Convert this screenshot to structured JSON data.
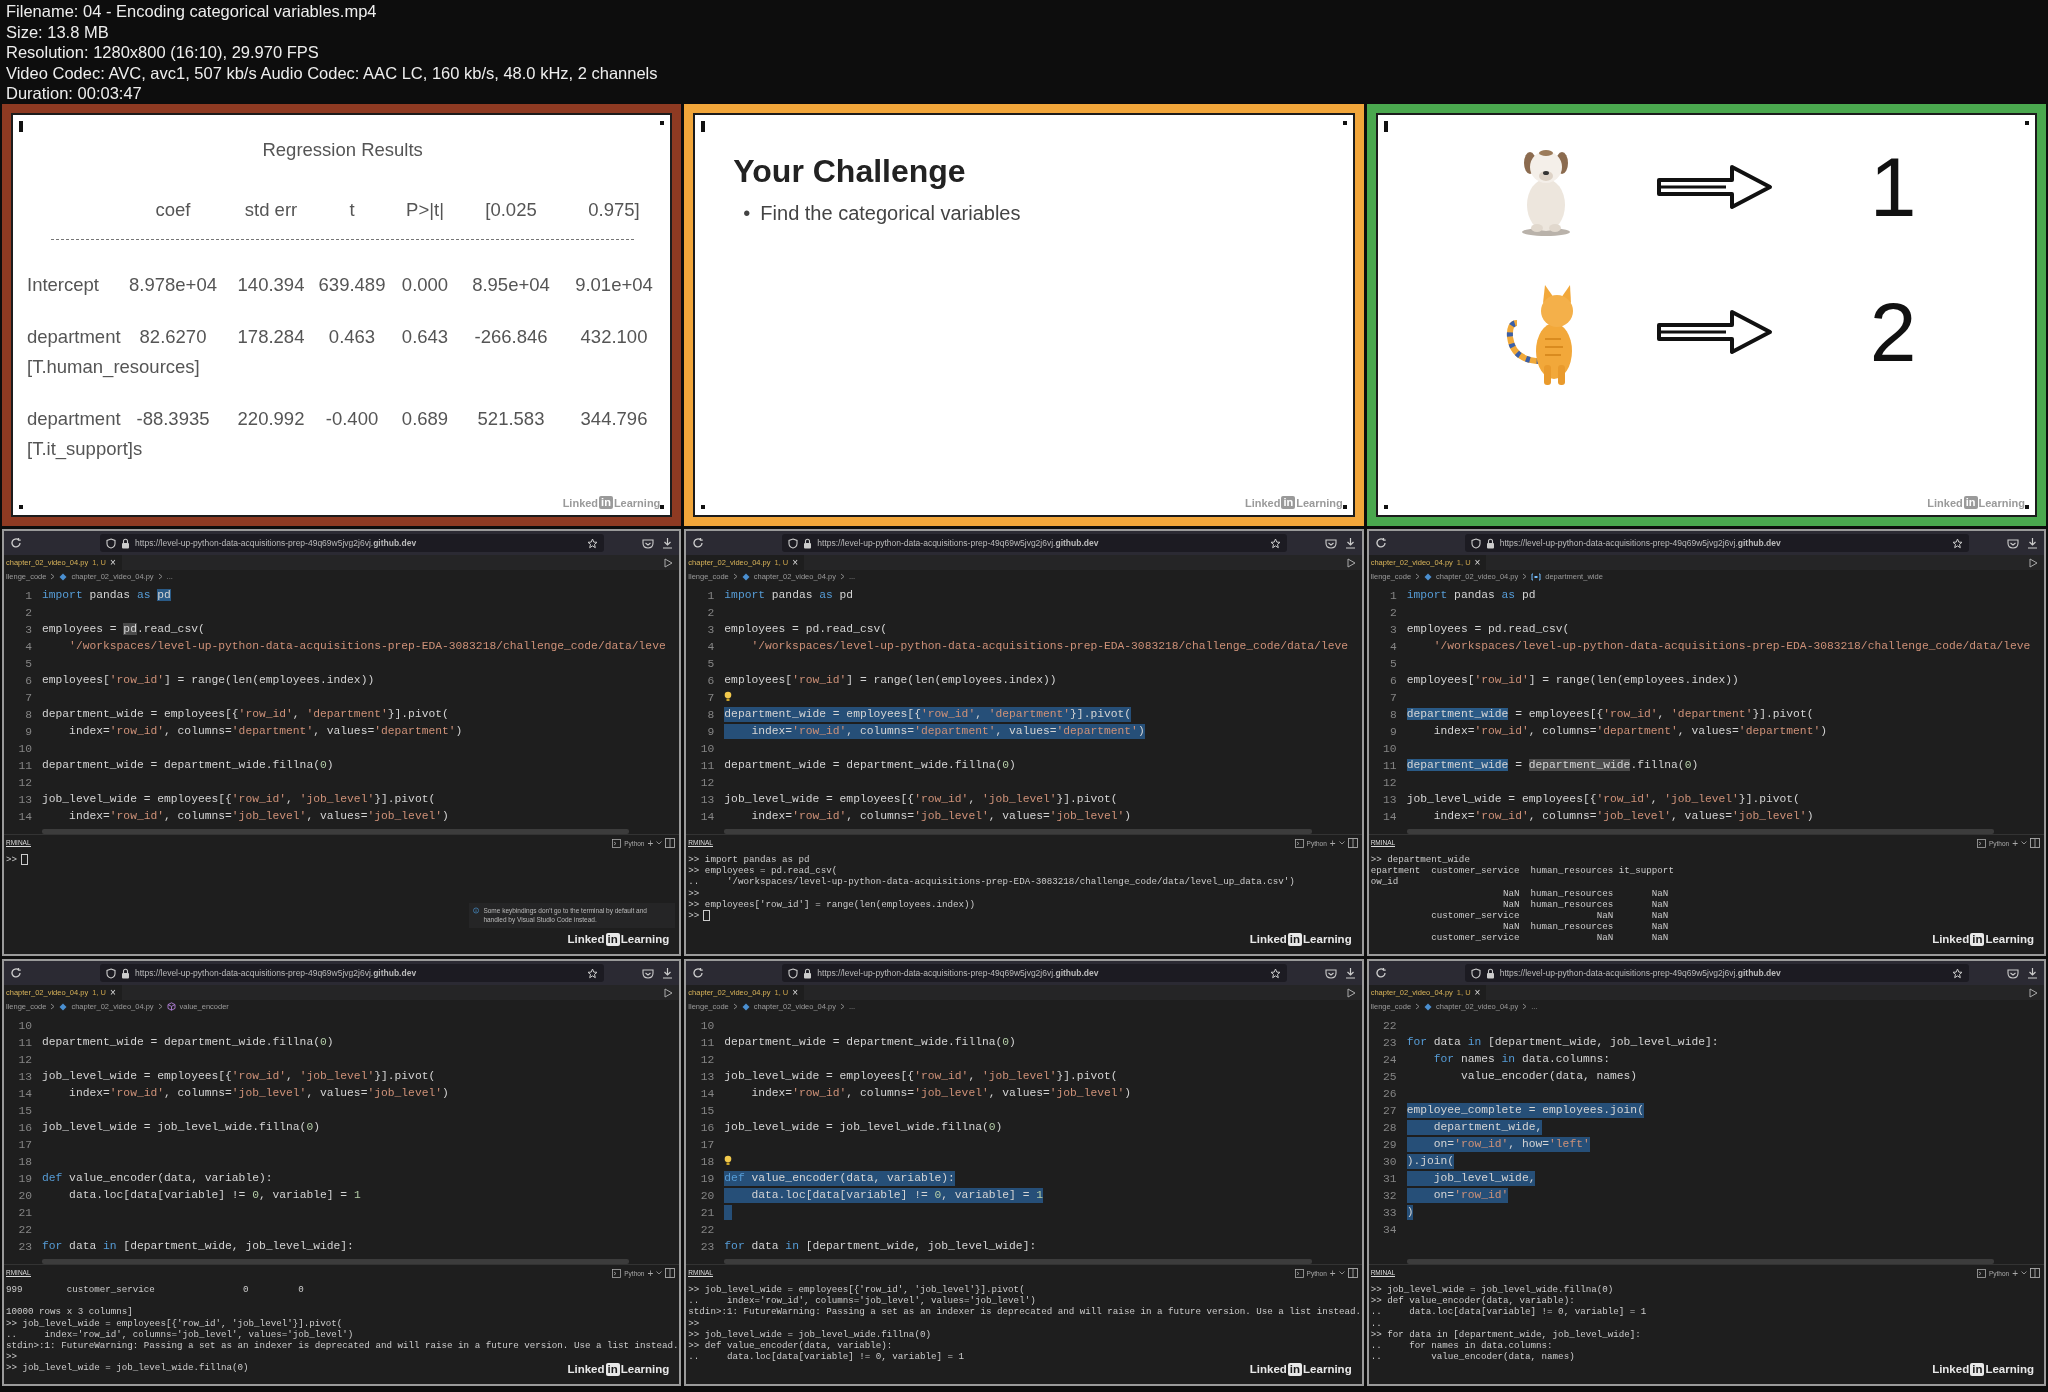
{
  "header": [
    "Filename: 04 - Encoding categorical variables.mp4",
    "Size: 13.8 MB",
    "Resolution: 1280x800 (16:10), 29.970 FPS",
    "Video Codec: AVC, avc1, 507 kb/s Audio Codec: AAC LC, 160 kb/s, 48.0 kHz, 2 channels",
    "Duration: 00:03:47"
  ],
  "frames": [
    {
      "kind": "regression",
      "color": "#8e3a22",
      "title": "Regression Results",
      "columns": [
        "coef",
        "std err",
        "t",
        "P>|t|",
        "[0.025",
        "0.975]"
      ],
      "rows": [
        {
          "label": "Intercept",
          "values": [
            "8.978e+04",
            "140.394",
            "639.489",
            "0.000",
            "8.95e+04",
            "9.01e+04"
          ]
        },
        {
          "label": "department",
          "sublabel": "[T.human_resources]",
          "values": [
            "82.6270",
            "178.284",
            "0.463",
            "0.643",
            "-266.846",
            "432.100"
          ]
        },
        {
          "label": "department",
          "sublabel": "[T.it_support]s",
          "values": [
            "-88.3935",
            "220.992",
            "-0.400",
            "0.689",
            "521.583",
            "344.796"
          ]
        }
      ],
      "logo": {
        "word1": "Linked",
        "badge": "in",
        "word2": "Learning"
      }
    },
    {
      "kind": "challenge",
      "color": "#f2a63a",
      "title": "Your Challenge",
      "bullets": [
        {
          "marker": "•",
          "text": "Find the categorical variables"
        }
      ],
      "logo": {
        "word1": "Linked",
        "badge": "in",
        "word2": "Learning"
      }
    },
    {
      "kind": "encoding",
      "color": "#4aa84e",
      "items": [
        {
          "kind": "dog",
          "value": "1"
        },
        {
          "kind": "cat",
          "value": "2"
        }
      ],
      "logo": {
        "word1": "Linked",
        "badge": "in",
        "word2": "Learning"
      }
    },
    {
      "kind": "editor",
      "url": "https://level-up-python-data-acquisitions-prep-49q69w5jvg2j6vj.**github.dev**",
      "tab": "chapter_02_video_04.py",
      "tab_status": "1, U",
      "tab_close": "×",
      "breadcrumb": [
        {
          "text": "llenge_code",
          "kind": "folder"
        },
        {
          "text": "chapter_02_video_04.py",
          "kind": "file"
        },
        {
          "text": "...",
          "kind": "more"
        }
      ],
      "lines": [
        {
          "n": "1",
          "selected": false,
          "code": [
            {
              "t": "import",
              "kind": "kw"
            },
            {
              "t": " pandas "
            },
            {
              "t": "as ",
              "kind": "kw"
            },
            {
              "t": "pd",
              "kind": "match"
            }
          ]
        },
        {
          "n": "2",
          "selected": false
        },
        {
          "n": "3",
          "selected": false,
          "code": [
            {
              "t": "employees = "
            },
            {
              "t": "pd",
              "kind": "ref"
            },
            {
              "t": ".read_csv("
            }
          ]
        },
        {
          "n": "4",
          "selected": false,
          "code": [
            {
              "t": "    '/workspaces/level-up-python-data-acquisitions-prep-EDA-3083218/challenge_code/data/leve",
              "kind": "str"
            }
          ]
        },
        {
          "n": "5",
          "selected": false
        },
        {
          "n": "6",
          "selected": false,
          "code": [
            {
              "t": "employees["
            },
            {
              "t": "'row_id'",
              "kind": "str"
            },
            {
              "t": "] = range(len(employees.index))"
            }
          ]
        },
        {
          "n": "7",
          "selected": false
        },
        {
          "n": "8",
          "selected": false,
          "code": [
            {
              "t": "department_wide = employees[{"
            },
            {
              "t": "'row_id'",
              "kind": "str"
            },
            {
              "t": ", "
            },
            {
              "t": "'department'",
              "kind": "str"
            },
            {
              "t": "}].pivot("
            }
          ]
        },
        {
          "n": "9",
          "selected": false,
          "code": [
            {
              "t": "    index="
            },
            {
              "t": "'row_id'",
              "kind": "str"
            },
            {
              "t": ", columns="
            },
            {
              "t": "'department'",
              "kind": "str"
            },
            {
              "t": ", values="
            },
            {
              "t": "'department'",
              "kind": "str"
            },
            {
              "t": ")"
            }
          ]
        },
        {
          "n": "10",
          "selected": false
        },
        {
          "n": "11",
          "selected": false,
          "code": [
            {
              "t": "department_wide = department_wide.fillna("
            },
            {
              "t": "0",
              "kind": "num"
            },
            {
              "t": ")"
            }
          ]
        },
        {
          "n": "12",
          "selected": false
        },
        {
          "n": "13",
          "selected": false,
          "code": [
            {
              "t": "job_level_wide = employees[{"
            },
            {
              "t": "'row_id'",
              "kind": "str"
            },
            {
              "t": ", "
            },
            {
              "t": "'job_level'",
              "kind": "str"
            },
            {
              "t": "}].pivot("
            }
          ]
        },
        {
          "n": "14",
          "selected": false,
          "code": [
            {
              "t": "    index="
            },
            {
              "t": "'row_id'",
              "kind": "str"
            },
            {
              "t": ", columns="
            },
            {
              "t": "'job_level'",
              "kind": "str"
            },
            {
              "t": ", values="
            },
            {
              "t": "'job_level'",
              "kind": "str"
            },
            {
              "t": ")"
            }
          ]
        }
      ],
      "terminal_label": "RMINAL",
      "shell": "Python",
      "plus": "+",
      "terminal": [
        {
          "text": ">>"
        }
      ],
      "cursor": true,
      "notice": "Some keybindings don't go to the terminal by default and handled by Visual Studio Code instead.",
      "logo": {
        "word1": "Linked",
        "badge": "in",
        "word2": "Learning"
      }
    },
    {
      "kind": "editor",
      "url": "https://level-up-python-data-acquisitions-prep-49q69w5jvg2j6vj.**github.dev**",
      "tab": "chapter_02_video_04.py",
      "tab_status": "1, U",
      "tab_close": "×",
      "breadcrumb": [
        {
          "text": "llenge_code",
          "kind": "folder"
        },
        {
          "text": "chapter_02_video_04.py",
          "kind": "file"
        },
        {
          "text": "...",
          "kind": "more"
        }
      ],
      "lines": [
        {
          "n": "1",
          "selected": false,
          "code": [
            {
              "t": "import",
              "kind": "kw"
            },
            {
              "t": " pandas "
            },
            {
              "t": "as",
              "kind": "kw"
            },
            {
              "t": " pd"
            }
          ]
        },
        {
          "n": "2",
          "selected": false
        },
        {
          "n": "3",
          "selected": false,
          "code": [
            {
              "t": "employees = pd.read_csv("
            }
          ]
        },
        {
          "n": "4",
          "selected": false,
          "code": [
            {
              "t": "    '/workspaces/level-up-python-data-acquisitions-prep-EDA-3083218/challenge_code/data/leve",
              "kind": "str"
            }
          ]
        },
        {
          "n": "5",
          "selected": false
        },
        {
          "n": "6",
          "selected": false,
          "code": [
            {
              "t": "employees["
            },
            {
              "t": "'row_id'",
              "kind": "str"
            },
            {
              "t": "] = range(len(employees.index))"
            }
          ]
        },
        {
          "n": "7",
          "selected": false,
          "lightbulb": true
        },
        {
          "n": "8",
          "selected": true,
          "code": [
            {
              "t": "department_wide = employees[{"
            },
            {
              "t": "'row_id'",
              "kind": "str"
            },
            {
              "t": ", "
            },
            {
              "t": "'department'",
              "kind": "str"
            },
            {
              "t": "}].pivot("
            }
          ]
        },
        {
          "n": "9",
          "selected": true,
          "code": [
            {
              "t": "    index="
            },
            {
              "t": "'row_id'",
              "kind": "str"
            },
            {
              "t": ", columns="
            },
            {
              "t": "'department'",
              "kind": "str"
            },
            {
              "t": ", values="
            },
            {
              "t": "'department'",
              "kind": "str"
            },
            {
              "t": ")"
            }
          ]
        },
        {
          "n": "10",
          "selected": false
        },
        {
          "n": "11",
          "selected": false,
          "code": [
            {
              "t": "department_wide = department_wide.fillna("
            },
            {
              "t": "0",
              "kind": "num"
            },
            {
              "t": ")"
            }
          ]
        },
        {
          "n": "12",
          "selected": false
        },
        {
          "n": "13",
          "selected": false,
          "code": [
            {
              "t": "job_level_wide = employees[{"
            },
            {
              "t": "'row_id'",
              "kind": "str"
            },
            {
              "t": ", "
            },
            {
              "t": "'job_level'",
              "kind": "str"
            },
            {
              "t": "}].pivot("
            }
          ]
        },
        {
          "n": "14",
          "selected": false,
          "code": [
            {
              "t": "    index="
            },
            {
              "t": "'row_id'",
              "kind": "str"
            },
            {
              "t": ", columns="
            },
            {
              "t": "'job_level'",
              "kind": "str"
            },
            {
              "t": ", values="
            },
            {
              "t": "'job_level'",
              "kind": "str"
            },
            {
              "t": ")"
            }
          ]
        }
      ],
      "terminal_label": "RMINAL",
      "shell": "Python",
      "plus": "+",
      "terminal": [
        {
          "text": ">> import pandas as pd"
        },
        {
          "text": ">> employees = pd.read_csv("
        },
        {
          "text": "..     '/workspaces/level-up-python-data-acquisitions-prep-EDA-3083218/challenge_code/data/level_up_data.csv')"
        },
        {
          "text": ">>"
        },
        {
          "text": ">> employees['row_id'] = range(len(employees.index))"
        },
        {
          "text": ">>"
        }
      ],
      "cursor": true,
      "logo": {
        "word1": "Linked",
        "badge": "in",
        "word2": "Learning"
      }
    },
    {
      "kind": "editor",
      "url": "https://level-up-python-data-acquisitions-prep-49q69w5jvg2j6vj.**github.dev**",
      "tab": "chapter_02_video_04.py",
      "tab_status": "1, U",
      "tab_close": "×",
      "breadcrumb": [
        {
          "text": "llenge_code",
          "kind": "folder"
        },
        {
          "text": "chapter_02_video_04.py",
          "kind": "file"
        },
        {
          "text": "department_wide",
          "kind": "variable"
        }
      ],
      "lines": [
        {
          "n": "1",
          "selected": false,
          "code": [
            {
              "t": "import",
              "kind": "kw"
            },
            {
              "t": " pandas "
            },
            {
              "t": "as",
              "kind": "kw"
            },
            {
              "t": " pd"
            }
          ]
        },
        {
          "n": "2",
          "selected": false
        },
        {
          "n": "3",
          "selected": false,
          "code": [
            {
              "t": "employees = pd.read_csv("
            }
          ]
        },
        {
          "n": "4",
          "selected": false,
          "code": [
            {
              "t": "    '/workspaces/level-up-python-data-acquisitions-prep-EDA-3083218/challenge_code/data/leve",
              "kind": "str"
            }
          ]
        },
        {
          "n": "5",
          "selected": false
        },
        {
          "n": "6",
          "selected": false,
          "code": [
            {
              "t": "employees["
            },
            {
              "t": "'row_id'",
              "kind": "str"
            },
            {
              "t": "] = range(len(employees.index))"
            }
          ]
        },
        {
          "n": "7",
          "selected": false
        },
        {
          "n": "8",
          "selected": false,
          "code": [
            {
              "t": "department_wide",
              "kind": "match"
            },
            {
              "t": " = employees[{"
            },
            {
              "t": "'row_id'",
              "kind": "str"
            },
            {
              "t": ", "
            },
            {
              "t": "'department'",
              "kind": "str"
            },
            {
              "t": "}].pivot("
            }
          ]
        },
        {
          "n": "9",
          "selected": false,
          "code": [
            {
              "t": "    index="
            },
            {
              "t": "'row_id'",
              "kind": "str"
            },
            {
              "t": ", columns="
            },
            {
              "t": "'department'",
              "kind": "str"
            },
            {
              "t": ", values="
            },
            {
              "t": "'department'",
              "kind": "str"
            },
            {
              "t": ")"
            }
          ]
        },
        {
          "n": "10",
          "selected": false
        },
        {
          "n": "11",
          "selected": false,
          "code": [
            {
              "t": "department_wide",
              "kind": "match"
            },
            {
              "t": " = "
            },
            {
              "t": "department_wide",
              "kind": "ref"
            },
            {
              "t": ".fillna("
            },
            {
              "t": "0",
              "kind": "num"
            },
            {
              "t": ")"
            }
          ]
        },
        {
          "n": "12",
          "selected": false
        },
        {
          "n": "13",
          "selected": false,
          "code": [
            {
              "t": "job_level_wide = employees[{"
            },
            {
              "t": "'row_id'",
              "kind": "str"
            },
            {
              "t": ", "
            },
            {
              "t": "'job_level'",
              "kind": "str"
            },
            {
              "t": "}].pivot("
            }
          ]
        },
        {
          "n": "14",
          "selected": false,
          "code": [
            {
              "t": "    index="
            },
            {
              "t": "'row_id'",
              "kind": "str"
            },
            {
              "t": ", columns="
            },
            {
              "t": "'job_level'",
              "kind": "str"
            },
            {
              "t": ", values="
            },
            {
              "t": "'job_level'",
              "kind": "str"
            },
            {
              "t": ")"
            }
          ]
        }
      ],
      "terminal_label": "RMINAL",
      "shell": "Python",
      "plus": "+",
      "terminal": [
        {
          "text": ">> department_wide"
        },
        {
          "text": "epartment  customer_service  human_resources it_support"
        },
        {
          "text": "ow_id"
        },
        {
          "text": "                        NaN  human_resources       NaN"
        },
        {
          "text": "                        NaN  human_resources       NaN"
        },
        {
          "text": "           customer_service              NaN       NaN"
        },
        {
          "text": "                        NaN  human_resources       NaN"
        },
        {
          "text": "           customer_service              NaN       NaN"
        }
      ],
      "cursor": false,
      "logo": {
        "word1": "Linked",
        "badge": "in",
        "word2": "Learning"
      }
    },
    {
      "kind": "editor",
      "url": "https://level-up-python-data-acquisitions-prep-49q69w5jvg2j6vj.**github.dev**",
      "tab": "chapter_02_video_04.py",
      "tab_status": "1, U",
      "tab_close": "×",
      "breadcrumb": [
        {
          "text": "llenge_code",
          "kind": "folder"
        },
        {
          "text": "chapter_02_video_04.py",
          "kind": "file"
        },
        {
          "text": "value_encoder",
          "kind": "function"
        }
      ],
      "lines": [
        {
          "n": "10",
          "selected": false
        },
        {
          "n": "11",
          "selected": false,
          "code": [
            {
              "t": "department_wide = department_wide.fillna("
            },
            {
              "t": "0",
              "kind": "num"
            },
            {
              "t": ")"
            }
          ]
        },
        {
          "n": "12",
          "selected": false
        },
        {
          "n": "13",
          "selected": false,
          "code": [
            {
              "t": "job_level_wide = employees[{"
            },
            {
              "t": "'row_id'",
              "kind": "str"
            },
            {
              "t": ", "
            },
            {
              "t": "'job_level'",
              "kind": "str"
            },
            {
              "t": "}].pivot("
            }
          ]
        },
        {
          "n": "14",
          "selected": false,
          "code": [
            {
              "t": "    index="
            },
            {
              "t": "'row_id'",
              "kind": "str"
            },
            {
              "t": ", columns="
            },
            {
              "t": "'job_level'",
              "kind": "str"
            },
            {
              "t": ", values="
            },
            {
              "t": "'job_level'",
              "kind": "str"
            },
            {
              "t": ")"
            }
          ]
        },
        {
          "n": "15",
          "selected": false
        },
        {
          "n": "16",
          "selected": false,
          "code": [
            {
              "t": "job_level_wide = job_level_wide.fillna("
            },
            {
              "t": "0",
              "kind": "num"
            },
            {
              "t": ")"
            }
          ]
        },
        {
          "n": "17",
          "selected": false
        },
        {
          "n": "18",
          "selected": false
        },
        {
          "n": "19",
          "selected": false,
          "code": [
            {
              "t": "def",
              "kind": "kw"
            },
            {
              "t": " value_encoder(data, variable):"
            }
          ]
        },
        {
          "n": "20",
          "selected": false,
          "code": [
            {
              "t": "    data.loc[data[variable] != "
            },
            {
              "t": "0",
              "kind": "num"
            },
            {
              "t": ", variable] = "
            },
            {
              "t": "1",
              "kind": "num"
            }
          ]
        },
        {
          "n": "21",
          "selected": false
        },
        {
          "n": "22",
          "selected": false
        },
        {
          "n": "23",
          "selected": false,
          "code": [
            {
              "t": "for",
              "kind": "kw"
            },
            {
              "t": " data "
            },
            {
              "t": "in",
              "kind": "kw"
            },
            {
              "t": " [department_wide, job_level_wide]:"
            }
          ]
        }
      ],
      "terminal_label": "RMINAL",
      "shell": "Python",
      "plus": "+",
      "terminal": [
        {
          "text": "999        customer_service                0         0"
        },
        {
          "text": "10000 rows x 3 columns]",
          "spaced": true
        },
        {
          "text": ">> job_level_wide = employees[{'row_id', 'job_level'}].pivot("
        },
        {
          "text": "..     index='row_id', columns='job_level', values='job_level')"
        },
        {
          "text": "stdin>:1: FutureWarning: Passing a set as an indexer is deprecated and will raise in a future version. Use a list instead."
        },
        {
          "text": ">>"
        },
        {
          "text": ">> job_level_wide = job_level_wide.fillna(0)"
        }
      ],
      "cursor": false,
      "logo": {
        "word1": "Linked",
        "badge": "in",
        "word2": "Learning"
      }
    },
    {
      "kind": "editor",
      "url": "https://level-up-python-data-acquisitions-prep-49q69w5jvg2j6vj.**github.dev**",
      "tab": "chapter_02_video_04.py",
      "tab_status": "1, U",
      "tab_close": "×",
      "breadcrumb": [
        {
          "text": "llenge_code",
          "kind": "folder"
        },
        {
          "text": "chapter_02_video_04.py",
          "kind": "file"
        },
        {
          "text": "...",
          "kind": "more"
        }
      ],
      "lines": [
        {
          "n": "10",
          "selected": false
        },
        {
          "n": "11",
          "selected": false,
          "code": [
            {
              "t": "department_wide = department_wide.fillna("
            },
            {
              "t": "0",
              "kind": "num"
            },
            {
              "t": ")"
            }
          ]
        },
        {
          "n": "12",
          "selected": false
        },
        {
          "n": "13",
          "selected": false,
          "code": [
            {
              "t": "job_level_wide = employees[{"
            },
            {
              "t": "'row_id'",
              "kind": "str"
            },
            {
              "t": ", "
            },
            {
              "t": "'job_level'",
              "kind": "str"
            },
            {
              "t": "}].pivot("
            }
          ]
        },
        {
          "n": "14",
          "selected": false,
          "code": [
            {
              "t": "    index="
            },
            {
              "t": "'row_id'",
              "kind": "str"
            },
            {
              "t": ", columns="
            },
            {
              "t": "'job_level'",
              "kind": "str"
            },
            {
              "t": ", values="
            },
            {
              "t": "'job_level'",
              "kind": "str"
            },
            {
              "t": ")"
            }
          ]
        },
        {
          "n": "15",
          "selected": false
        },
        {
          "n": "16",
          "selected": false,
          "code": [
            {
              "t": "job_level_wide = job_level_wide.fillna("
            },
            {
              "t": "0",
              "kind": "num"
            },
            {
              "t": ")"
            }
          ]
        },
        {
          "n": "17",
          "selected": false
        },
        {
          "n": "18",
          "selected": false,
          "lightbulb": true
        },
        {
          "n": "19",
          "selected": true,
          "code": [
            {
              "t": "def",
              "kind": "kw"
            },
            {
              "t": " value_encoder(data, variable):"
            }
          ]
        },
        {
          "n": "20",
          "selected": true,
          "code": [
            {
              "t": "    data.loc[data[variable] != "
            },
            {
              "t": "0",
              "kind": "num"
            },
            {
              "t": ", variable] = "
            },
            {
              "t": "1",
              "kind": "num"
            }
          ]
        },
        {
          "n": "21",
          "selected": true
        },
        {
          "n": "22",
          "selected": false
        },
        {
          "n": "23",
          "selected": false,
          "code": [
            {
              "t": "for",
              "kind": "kw"
            },
            {
              "t": " data "
            },
            {
              "t": "in",
              "kind": "kw"
            },
            {
              "t": " [department_wide, job_level_wide]:"
            }
          ]
        }
      ],
      "terminal_label": "RMINAL",
      "shell": "Python",
      "plus": "+",
      "terminal": [
        {
          "text": ">> job_level_wide = employees[{'row_id', 'job_level'}].pivot("
        },
        {
          "text": "..     index='row_id', columns='job_level', values='job_level')"
        },
        {
          "text": "stdin>:1: FutureWarning: Passing a set as an indexer is deprecated and will raise in a future version. Use a list instead."
        },
        {
          "text": ">>"
        },
        {
          "text": ">> job_level_wide = job_level_wide.fillna(0)"
        },
        {
          "text": ">> def value_encoder(data, variable):"
        },
        {
          "text": "..     data.loc[data[variable] != 0, variable] = 1"
        }
      ],
      "cursor": false,
      "logo": {
        "word1": "Linked",
        "badge": "in",
        "word2": "Learning"
      }
    },
    {
      "kind": "editor",
      "url": "https://level-up-python-data-acquisitions-prep-49q69w5jvg2j6vj.**github.dev**",
      "tab": "chapter_02_video_04.py",
      "tab_status": "1, U",
      "tab_close": "×",
      "breadcrumb": [
        {
          "text": "llenge_code",
          "kind": "folder"
        },
        {
          "text": "chapter_02_video_04.py",
          "kind": "file"
        },
        {
          "text": "...",
          "kind": "more"
        }
      ],
      "lines": [
        {
          "n": "22",
          "selected": false
        },
        {
          "n": "23",
          "selected": false,
          "code": [
            {
              "t": "for",
              "kind": "kw"
            },
            {
              "t": " data "
            },
            {
              "t": "in",
              "kind": "kw"
            },
            {
              "t": " [department_wide, job_level_wide]:"
            }
          ]
        },
        {
          "n": "24",
          "selected": false,
          "code": [
            {
              "t": "    for",
              "kind": "kw"
            },
            {
              "t": " names "
            },
            {
              "t": "in",
              "kind": "kw"
            },
            {
              "t": " data.columns:"
            }
          ]
        },
        {
          "n": "25",
          "selected": false,
          "code": [
            {
              "t": "        value_encoder(data, names)"
            }
          ]
        },
        {
          "n": "26",
          "selected": false
        },
        {
          "n": "27",
          "selected": true,
          "code": [
            {
              "t": "employee_complete = employees.join("
            }
          ]
        },
        {
          "n": "28",
          "selected": true,
          "code": [
            {
              "t": "    department_wide,"
            }
          ]
        },
        {
          "n": "29",
          "selected": true,
          "code": [
            {
              "t": "    on="
            },
            {
              "t": "'row_id'",
              "kind": "str"
            },
            {
              "t": ", how="
            },
            {
              "t": "'left'",
              "kind": "str"
            }
          ]
        },
        {
          "n": "30",
          "selected": true,
          "code": [
            {
              "t": ").join("
            }
          ]
        },
        {
          "n": "31",
          "selected": true,
          "code": [
            {
              "t": "    job_level_wide,"
            }
          ]
        },
        {
          "n": "32",
          "selected": true,
          "code": [
            {
              "t": "    on="
            },
            {
              "t": "'row_id'",
              "kind": "str"
            }
          ]
        },
        {
          "n": "33",
          "selected": true,
          "code": [
            {
              "t": ")"
            }
          ]
        },
        {
          "n": "34",
          "selected": false
        }
      ],
      "terminal_label": "RMINAL",
      "shell": "Python",
      "plus": "+",
      "terminal": [
        {
          "text": ">> job_level_wide = job_level_wide.fillna(0)"
        },
        {
          "text": ">> def value_encoder(data, variable):"
        },
        {
          "text": "..     data.loc[data[variable] != 0, variable] = 1"
        },
        {
          "text": ".."
        },
        {
          "text": ">> for data in [department_wide, job_level_wide]:"
        },
        {
          "text": "..     for names in data.columns:"
        },
        {
          "text": "..         value_encoder(data, names)"
        }
      ],
      "cursor": false,
      "logo": {
        "word1": "Linked",
        "badge": "in",
        "word2": "Learning"
      }
    }
  ]
}
